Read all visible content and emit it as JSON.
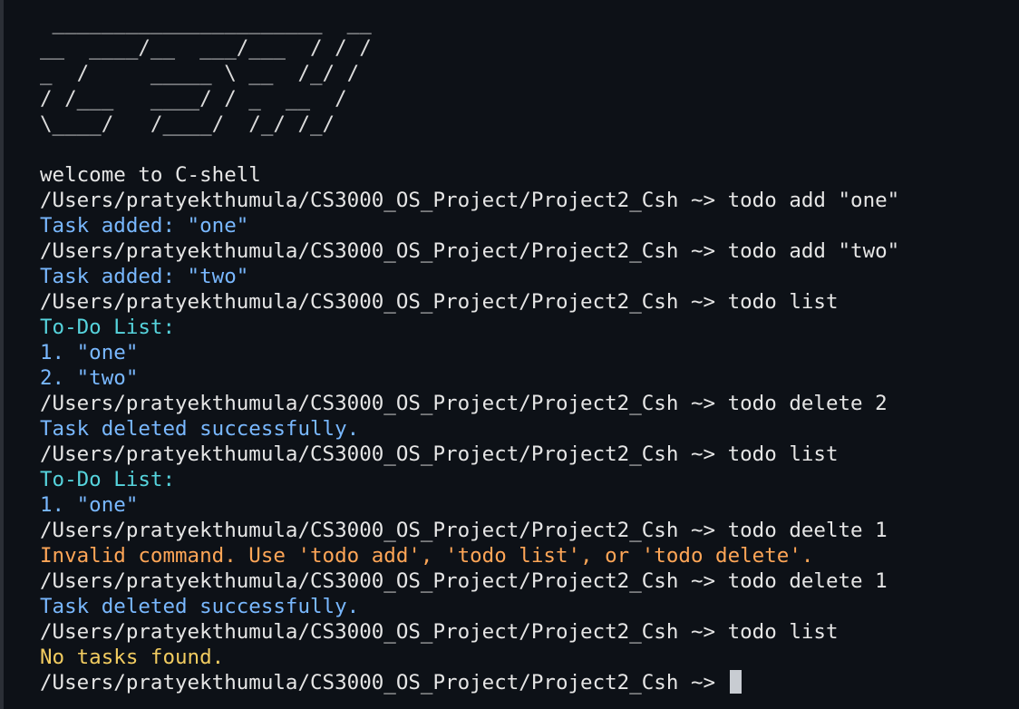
{
  "banner": [
    " ______________________  __",
    "__  ____/__  ___/___  / / /",
    "_  /     _____ \\ __  /_/ /",
    "/ /___   ____/ / _  __  /",
    "\\____/   /____/  /_/ /_/"
  ],
  "welcome": "welcome to C-shell",
  "output_lines": [
    {
      "kind": "command",
      "text": "/Users/pratyekthumula/CS3000_OS_Project/Project2_Csh ~> todo add \"one\""
    },
    {
      "kind": "info",
      "text": "Task added: \"one\""
    },
    {
      "kind": "command",
      "text": "/Users/pratyekthumula/CS3000_OS_Project/Project2_Csh ~> todo add \"two\""
    },
    {
      "kind": "info",
      "text": "Task added: \"two\""
    },
    {
      "kind": "command",
      "text": "/Users/pratyekthumula/CS3000_OS_Project/Project2_Csh ~> todo list"
    },
    {
      "kind": "header",
      "text": "To-Do List:"
    },
    {
      "kind": "info",
      "text": "1. \"one\""
    },
    {
      "kind": "info",
      "text": "2. \"two\""
    },
    {
      "kind": "command",
      "text": "/Users/pratyekthumula/CS3000_OS_Project/Project2_Csh ~> todo delete 2"
    },
    {
      "kind": "info",
      "text": "Task deleted successfully."
    },
    {
      "kind": "command",
      "text": "/Users/pratyekthumula/CS3000_OS_Project/Project2_Csh ~> todo list"
    },
    {
      "kind": "header",
      "text": "To-Do List:"
    },
    {
      "kind": "info",
      "text": "1. \"one\""
    },
    {
      "kind": "command",
      "text": "/Users/pratyekthumula/CS3000_OS_Project/Project2_Csh ~> todo deelte 1"
    },
    {
      "kind": "error",
      "text": "Invalid command. Use 'todo add', 'todo list', or 'todo delete'."
    },
    {
      "kind": "command",
      "text": "/Users/pratyekthumula/CS3000_OS_Project/Project2_Csh ~> todo delete 1"
    },
    {
      "kind": "info",
      "text": "Task deleted successfully."
    },
    {
      "kind": "command",
      "text": "/Users/pratyekthumula/CS3000_OS_Project/Project2_Csh ~> todo list"
    },
    {
      "kind": "warn",
      "text": "No tasks found."
    }
  ],
  "prompt": "/Users/pratyekthumula/CS3000_OS_Project/Project2_Csh ~> ",
  "colors": {
    "background": "#0d1117",
    "text": "#e6e6e6",
    "info": "#79b8ff",
    "header": "#56d4dd",
    "error": "#ffa657",
    "warn": "#f2cc60"
  }
}
